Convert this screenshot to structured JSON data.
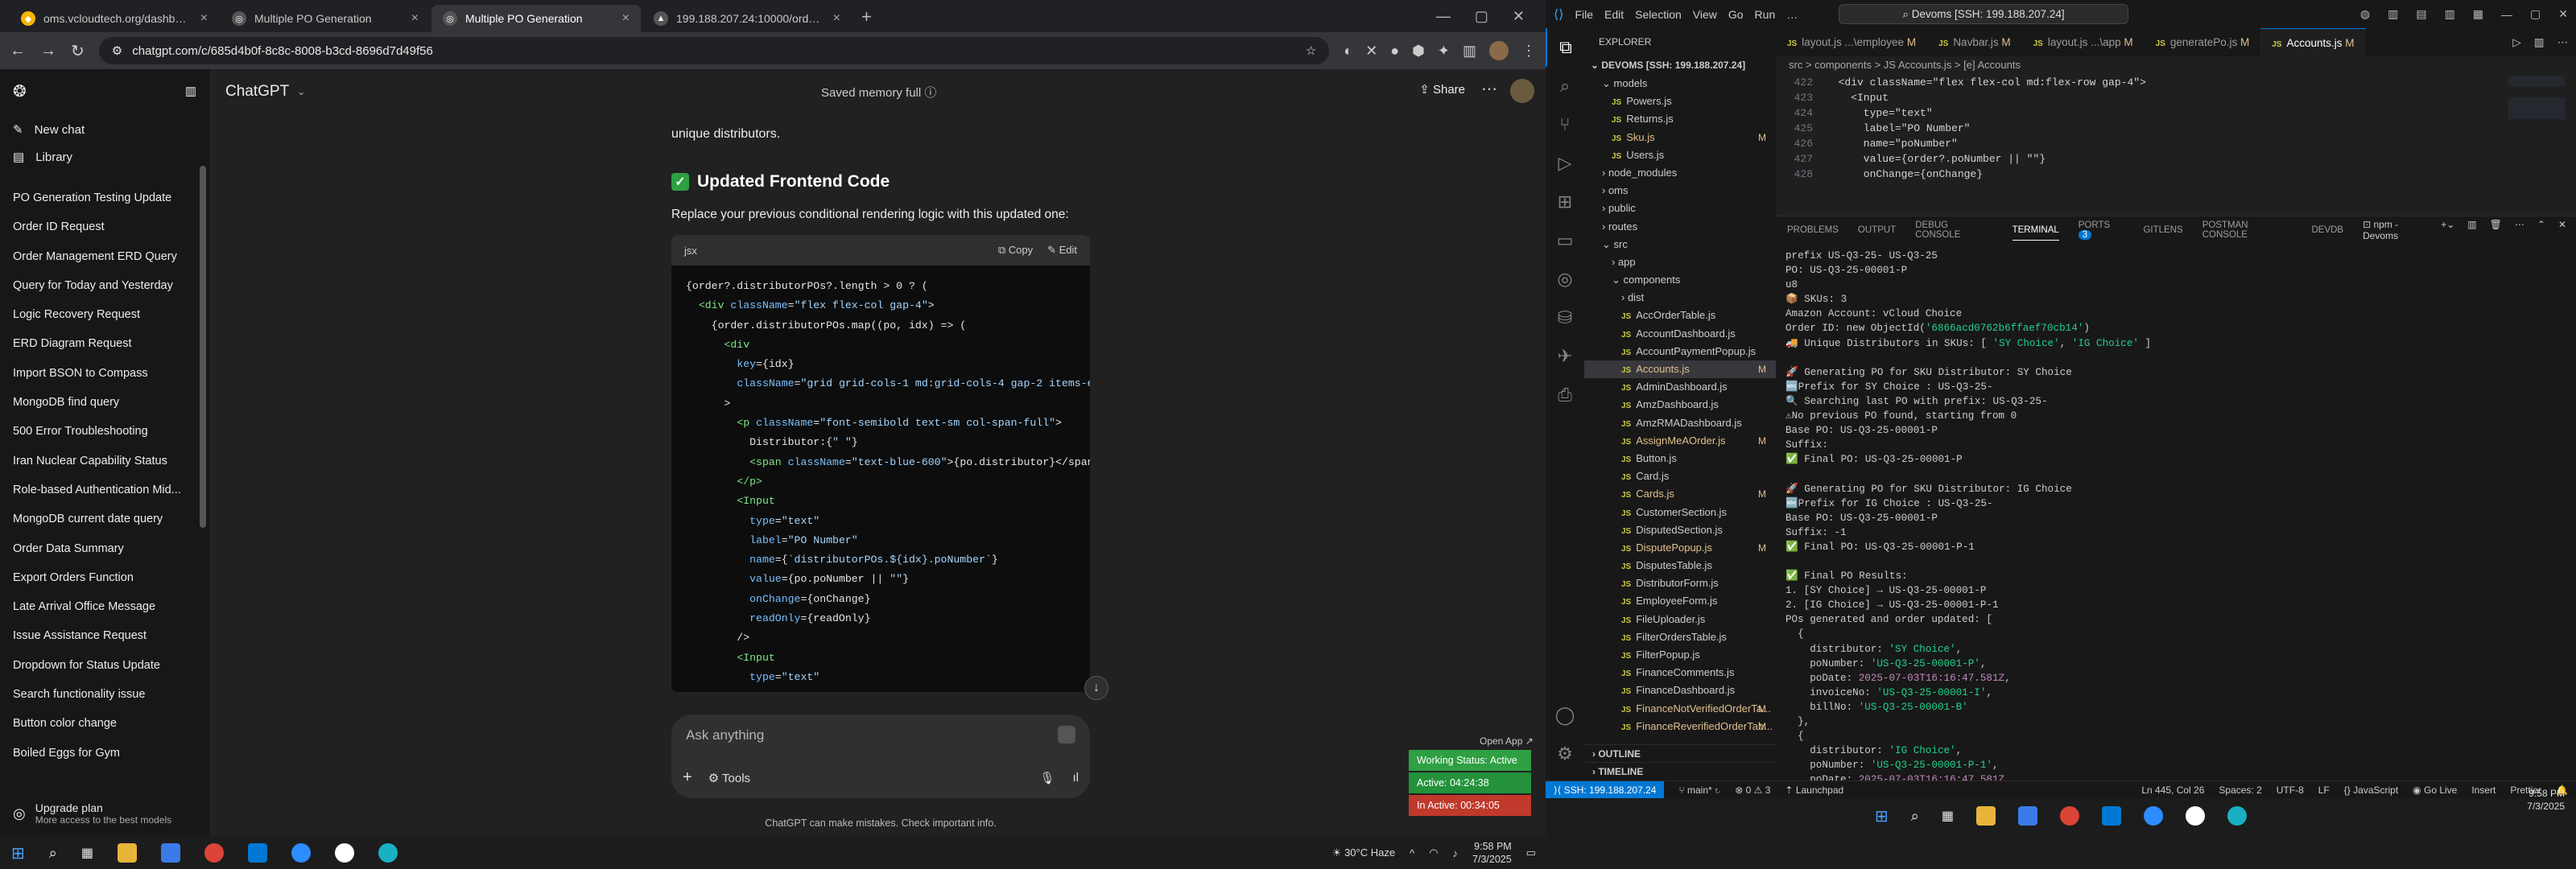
{
  "browser": {
    "tabs": [
      {
        "title": "oms.vcloudtech.org/dashboard",
        "color": "#f4b400"
      },
      {
        "title": "Multiple PO Generation",
        "color": "#555555"
      },
      {
        "title": "Multiple PO Generation",
        "color": "#555555"
      },
      {
        "title": "199.188.207.24:10000/orders/6",
        "color": "#555555"
      }
    ],
    "url": "chatgpt.com/c/685d4b0f-8c8c-8008-b3cd-8696d7d49f56"
  },
  "chatgpt": {
    "model": "ChatGPT",
    "saved_memory": "Saved memory full",
    "share": "Share",
    "sidebar": {
      "new_chat": "New chat",
      "library": "Library",
      "history": [
        "PO Generation Testing Update",
        "Order ID Request",
        "Order Management ERD Query",
        "Query for Today and Yesterday",
        "Logic Recovery Request",
        "ERD Diagram Request",
        "Import BSON to Compass",
        "MongoDB find query",
        "500 Error Troubleshooting",
        "Iran Nuclear Capability Status",
        "Role-based Authentication Mid...",
        "MongoDB current date query",
        "Order Data Summary",
        "Export Orders Function",
        "Late Arrival Office Message",
        "Issue Assistance Request",
        "Dropdown for Status Update",
        "Search functionality issue",
        "Button color change",
        "Boiled Eggs for Gym"
      ],
      "upgrade": "Upgrade plan",
      "upgrade_sub": "More access to the best models"
    },
    "message": {
      "intro": "unique distributors.",
      "heading": "Updated Frontend Code",
      "para": "Replace your previous conditional rendering logic with this updated one:",
      "code_lang": "jsx",
      "copy": "Copy",
      "edit": "Edit"
    },
    "composer": {
      "placeholder": "Ask anything",
      "tools": "Tools"
    },
    "disclaimer": "ChatGPT can make mistakes. Check important info.",
    "widget": {
      "open_app": "Open App",
      "working": "Working Status: Active",
      "active": "Active: 04:24:38",
      "inactive": "In Active: 00:34:05"
    }
  },
  "taskbar_left": {
    "weather": "30°C Haze",
    "time": "9:58 PM",
    "date": "7/3/2025"
  },
  "vscode": {
    "search": "Devoms [SSH: 199.188.207.24]",
    "menu": [
      "File",
      "Edit",
      "Selection",
      "View",
      "Go",
      "Run",
      "…"
    ],
    "explorer_title": "EXPLORER",
    "workspace": "DEVOMS [SSH: 199.188.207.24]",
    "tree": [
      {
        "label": "models",
        "type": "folder"
      },
      {
        "label": "Powers.js",
        "type": "js"
      },
      {
        "label": "Returns.js",
        "type": "js"
      },
      {
        "label": "Sku.js",
        "type": "js",
        "badge": "M"
      },
      {
        "label": "Users.js",
        "type": "js"
      },
      {
        "label": "node_modules",
        "type": "folder"
      },
      {
        "label": "oms",
        "type": "folder"
      },
      {
        "label": "public",
        "type": "folder"
      },
      {
        "label": "routes",
        "type": "folder"
      },
      {
        "label": "src",
        "type": "folder"
      },
      {
        "label": "app",
        "type": "folder"
      },
      {
        "label": "components",
        "type": "folder"
      },
      {
        "label": "dist",
        "type": "folder"
      },
      {
        "label": "AccOrderTable.js",
        "type": "js"
      },
      {
        "label": "AccountDashboard.js",
        "type": "js"
      },
      {
        "label": "AccountPaymentPopup.js",
        "type": "js"
      },
      {
        "label": "Accounts.js",
        "type": "js",
        "badge": "M",
        "selected": true
      },
      {
        "label": "AdminDashboard.js",
        "type": "js"
      },
      {
        "label": "AmzDashboard.js",
        "type": "js"
      },
      {
        "label": "AmzRMADashboard.js",
        "type": "js"
      },
      {
        "label": "AssignMeAOrder.js",
        "type": "js",
        "badge": "M"
      },
      {
        "label": "Button.js",
        "type": "js"
      },
      {
        "label": "Card.js",
        "type": "js"
      },
      {
        "label": "Cards.js",
        "type": "js",
        "badge": "M"
      },
      {
        "label": "CustomerSection.js",
        "type": "js"
      },
      {
        "label": "DisputedSection.js",
        "type": "js"
      },
      {
        "label": "DisputePopup.js",
        "type": "js",
        "badge": "M"
      },
      {
        "label": "DisputesTable.js",
        "type": "js"
      },
      {
        "label": "DistributorForm.js",
        "type": "js"
      },
      {
        "label": "EmployeeForm.js",
        "type": "js"
      },
      {
        "label": "FileUploader.js",
        "type": "js"
      },
      {
        "label": "FilterOrdersTable.js",
        "type": "js"
      },
      {
        "label": "FilterPopup.js",
        "type": "js"
      },
      {
        "label": "FinanceComments.js",
        "type": "js"
      },
      {
        "label": "FinanceDashboard.js",
        "type": "js"
      },
      {
        "label": "FinanceNotVerifiedOrderTa...",
        "type": "js",
        "badge": "M"
      },
      {
        "label": "FinanceReverifiedOrderTab...",
        "type": "js",
        "badge": "M"
      }
    ],
    "outline": "OUTLINE",
    "timeline": "TIMELINE",
    "tabs": [
      {
        "label": "layout.js ...\\employee",
        "badge": "M"
      },
      {
        "label": "Navbar.js",
        "badge": "M"
      },
      {
        "label": "layout.js ...\\app",
        "badge": "M"
      },
      {
        "label": "generatePo.js",
        "badge": "M"
      },
      {
        "label": "Accounts.js",
        "badge": "M",
        "active": true
      }
    ],
    "breadcrumb": "src > components > JS Accounts.js > [e] Accounts",
    "code_lines": [
      {
        "n": "422",
        "t": "  <div className=\"flex flex-col md:flex-row gap-4\">"
      },
      {
        "n": "423",
        "t": "    <Input"
      },
      {
        "n": "424",
        "t": "      type=\"text\""
      },
      {
        "n": "425",
        "t": "      label=\"PO Number\""
      },
      {
        "n": "426",
        "t": "      name=\"poNumber\""
      },
      {
        "n": "427",
        "t": "      value={order?.poNumber || \"\"}"
      },
      {
        "n": "428",
        "t": "      onChange={onChange}"
      }
    ],
    "panel_tabs": [
      "PROBLEMS",
      "OUTPUT",
      "DEBUG CONSOLE",
      "TERMINAL",
      "PORTS",
      "GITLENS",
      "POSTMAN CONSOLE",
      "DEVDB"
    ],
    "ports_count": "3",
    "terminal_task": "npm - Devoms",
    "status": {
      "remote": "SSH: 199.188.207.24",
      "branch": "main*",
      "launchpad": "Launchpad",
      "pos": "Ln 445, Col 26",
      "spaces": "Spaces: 2",
      "enc": "UTF-8",
      "eol": "LF",
      "lang": "JavaScript",
      "golive": "Go Live",
      "insert": "Insert",
      "prettier": "Prettier"
    },
    "taskbar": {
      "time": "9:58 PM",
      "date": "7/3/2025"
    }
  }
}
